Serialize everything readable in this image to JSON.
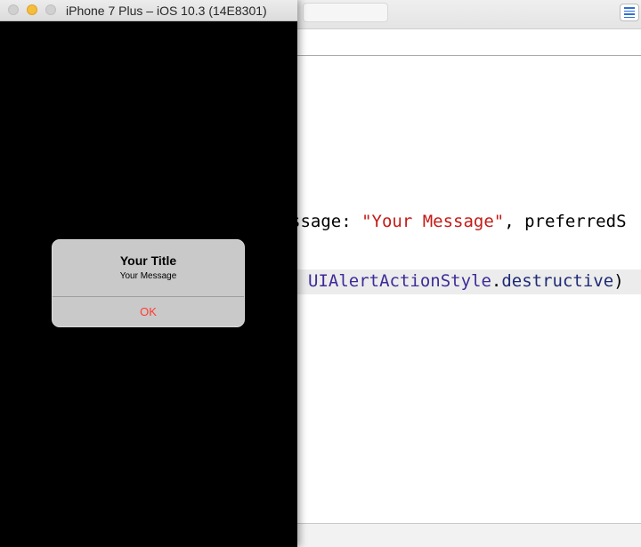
{
  "simulator": {
    "title": "iPhone 7 Plus – iOS 10.3 (14E8301)",
    "colors": {
      "screen_background": "#000000",
      "alert_background": "#c9c9c9",
      "destructive": "#ff3b30"
    }
  },
  "alert": {
    "title": "Your Title",
    "message": "Your Message",
    "button_label": "OK"
  },
  "editor": {
    "line1": {
      "prefix": "ssage: ",
      "string": "\"Your Message\"",
      "suffix": ", preferredS"
    },
    "line2": {
      "type": "UIAlertActionStyle",
      "dot": ".",
      "member": "destructive",
      "suffix": ")"
    },
    "icons": {
      "editor_toggle": "standard-editor-icon"
    }
  }
}
